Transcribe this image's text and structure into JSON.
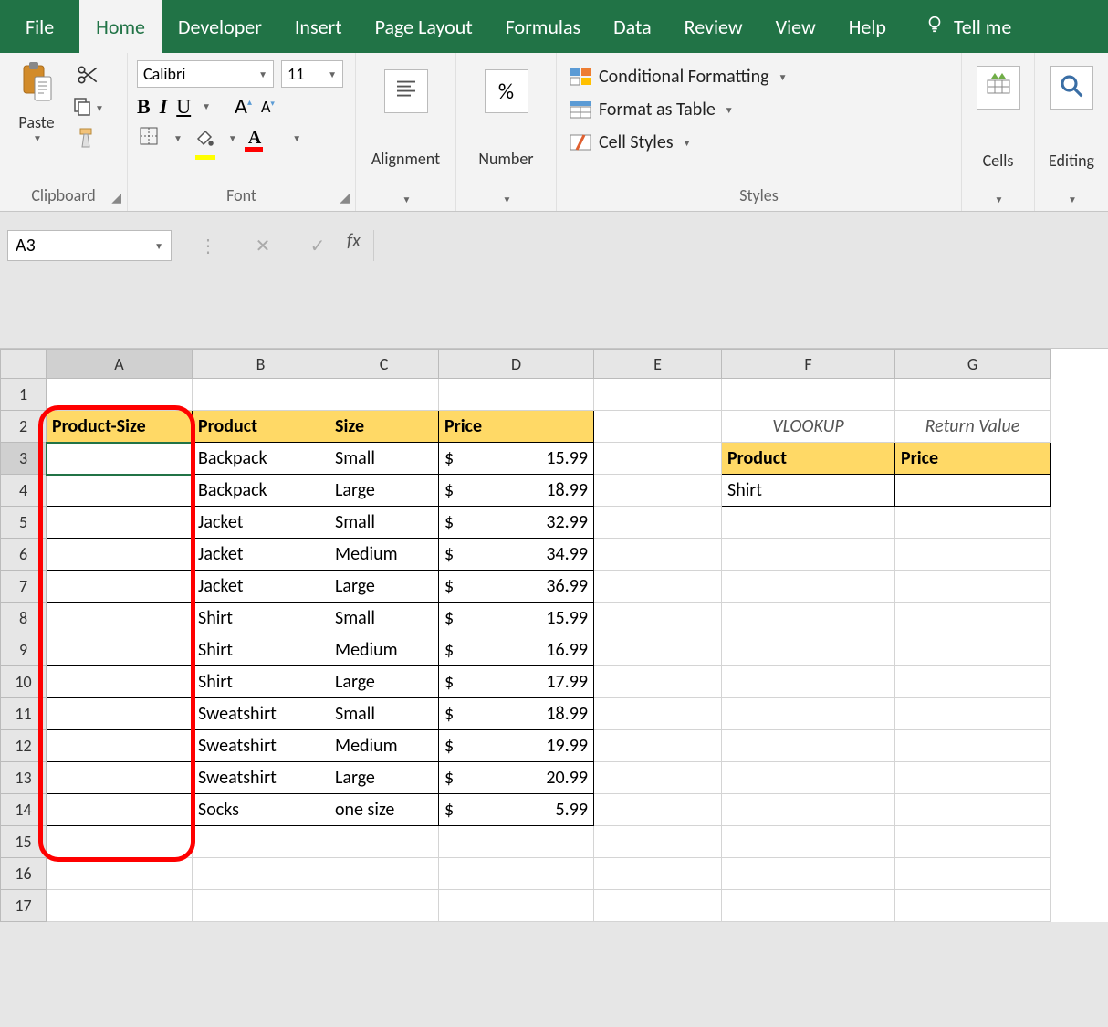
{
  "menu": {
    "file": "File",
    "home": "Home",
    "developer": "Developer",
    "insert": "Insert",
    "pagelayout": "Page Layout",
    "formulas": "Formulas",
    "data": "Data",
    "review": "Review",
    "view": "View",
    "help": "Help",
    "tellme": "Tell me"
  },
  "ribbon": {
    "clipboard": {
      "paste": "Paste",
      "label": "Clipboard"
    },
    "font": {
      "name": "Calibri",
      "size": "11",
      "label": "Font"
    },
    "alignment": {
      "label": "Alignment"
    },
    "number": {
      "label": "Number",
      "symbol": "%"
    },
    "styles": {
      "cond": "Conditional Formatting",
      "table": "Format as Table",
      "cell": "Cell Styles",
      "label": "Styles"
    },
    "cells": {
      "label": "Cells"
    },
    "editing": {
      "label": "Editing"
    }
  },
  "formula_bar": {
    "name_box": "A3",
    "fx": "fx",
    "formula": ""
  },
  "column_headers": [
    "A",
    "B",
    "C",
    "D",
    "E",
    "F",
    "G"
  ],
  "row_headers": [
    "1",
    "2",
    "3",
    "4",
    "5",
    "6",
    "7",
    "8",
    "9",
    "10",
    "11",
    "12",
    "13",
    "14",
    "15",
    "16",
    "17"
  ],
  "cells": {
    "A2": "Product-Size",
    "B2": "Product",
    "C2": "Size",
    "D2": "Price",
    "F2": "VLOOKUP",
    "G2": "Return Value",
    "F3": "Product",
    "G3": "Price",
    "F4": "Shirt",
    "table_rows": [
      {
        "product": "Backpack",
        "size": "Small",
        "price": "15.99"
      },
      {
        "product": "Backpack",
        "size": "Large",
        "price": "18.99"
      },
      {
        "product": "Jacket",
        "size": "Small",
        "price": "32.99"
      },
      {
        "product": "Jacket",
        "size": "Medium",
        "price": "34.99"
      },
      {
        "product": "Jacket",
        "size": "Large",
        "price": "36.99"
      },
      {
        "product": "Shirt",
        "size": "Small",
        "price": "15.99"
      },
      {
        "product": "Shirt",
        "size": "Medium",
        "price": "16.99"
      },
      {
        "product": "Shirt",
        "size": "Large",
        "price": "17.99"
      },
      {
        "product": "Sweatshirt",
        "size": "Small",
        "price": "18.99"
      },
      {
        "product": "Sweatshirt",
        "size": "Medium",
        "price": "19.99"
      },
      {
        "product": "Sweatshirt",
        "size": "Large",
        "price": "20.99"
      },
      {
        "product": "Socks",
        "size": "one size",
        "price": "5.99"
      }
    ],
    "dollar": "$"
  },
  "active_cell": "A3"
}
